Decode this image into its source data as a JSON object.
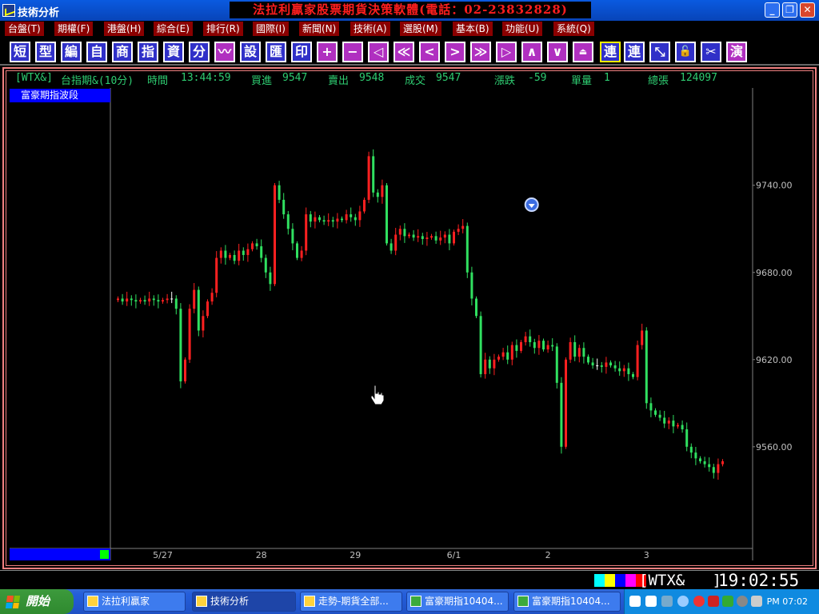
{
  "window": {
    "title": "技術分析",
    "banner": "法拉利贏家股票期貨決策軟體(電話：02-23832828)"
  },
  "window_buttons": [
    "_",
    "❐",
    "✕"
  ],
  "menu": [
    "台盤(T)",
    "期權(F)",
    "港盤(H)",
    "綜合(E)",
    "排行(R)",
    "國際(I)",
    "新聞(N)",
    "技術(A)",
    "選股(M)",
    "基本(B)",
    "功能(U)",
    "系統(Q)"
  ],
  "toolbar": [
    "短",
    "型",
    "編",
    "自",
    "商",
    "指",
    "資",
    "分",
    "〰",
    "設",
    "匯",
    "印",
    "+",
    "−",
    "◁",
    "≪",
    "<",
    ">",
    "≫",
    "▷",
    "∧",
    "∨",
    "⏏",
    "連",
    "連",
    "⤡",
    "🔓",
    "✂",
    "演"
  ],
  "quote": {
    "code": "[WTX&]",
    "name": "台指期&(10分)",
    "time_label": "時間",
    "time": "13:44:59",
    "bid_label": "買進",
    "bid": "9547",
    "ask_label": "賣出",
    "ask": "9548",
    "trade_label": "成交",
    "trade": "9547",
    "change_label": "漲跌",
    "change": "-59",
    "volume_label": "單量",
    "volume": "1",
    "total_label": "總張",
    "total": "124097"
  },
  "indicator_tag": "富豪期指波段",
  "chart_data": {
    "type": "candlestick",
    "title": "",
    "xlabel": "",
    "ylabel": "",
    "ylim": [
      9490,
      9807
    ],
    "y_ticks": [
      "9740.00",
      "9680.00",
      "9620.00",
      "9560.00"
    ],
    "x_ticks": [
      "5/27",
      "28",
      "29",
      "6/1",
      "2",
      "3"
    ],
    "close_path": [
      9662,
      9660,
      9662,
      9661,
      9660,
      9661,
      9660,
      9662,
      9661,
      9660,
      9661,
      9662,
      9662,
      9655,
      9605,
      9620,
      9655,
      9668,
      9640,
      9650,
      9660,
      9666,
      9690,
      9695,
      9690,
      9692,
      9688,
      9695,
      9692,
      9696,
      9700,
      9698,
      9690,
      9680,
      9672,
      9740,
      9730,
      9720,
      9710,
      9700,
      9690,
      9695,
      9720,
      9715,
      9718,
      9716,
      9715,
      9716,
      9715,
      9717,
      9716,
      9720,
      9718,
      9716,
      9722,
      9730,
      9760,
      9735,
      9732,
      9740,
      9700,
      9695,
      9706,
      9710,
      9705,
      9706,
      9704,
      9705,
      9703,
      9704,
      9705,
      9702,
      9704,
      9706,
      9700,
      9708,
      9710,
      9712,
      9680,
      9662,
      9650,
      9610,
      9620,
      9614,
      9620,
      9622,
      9625,
      9620,
      9630,
      9626,
      9632,
      9636,
      9632,
      9628,
      9633,
      9627,
      9630,
      9629,
      9604,
      9560,
      9620,
      9632,
      9622,
      9628,
      9622,
      9618,
      9616,
      9616,
      9615,
      9618,
      9616,
      9614,
      9612,
      9614,
      9610,
      9608,
      9630,
      9640,
      9590,
      9585,
      9582,
      9580,
      9576,
      9578,
      9574,
      9575,
      9572,
      9560,
      9556,
      9552,
      9550,
      9548,
      9546,
      9542,
      9548,
      9550
    ],
    "mark": {
      "candle": 92,
      "symbol": "down-arrow-circle"
    }
  },
  "status": {
    "code": "[WTX&   ]",
    "time": "19:02:55",
    "colors": [
      "#00ffff",
      "#ffff00",
      "#0000ff",
      "#ff00ff",
      "#ff0000"
    ]
  },
  "taskbar": {
    "start": "開始",
    "tasks": [
      "法拉利贏家",
      "技術分析",
      "走勢-期貨全部...",
      "富豪期指10404...",
      "富豪期指10404..."
    ],
    "clock": "PM 07:02"
  },
  "colors": {
    "up": "#ff2020",
    "down": "#30e060",
    "banner": "#ff1e1e",
    "quote_text": "#2ecc71"
  }
}
